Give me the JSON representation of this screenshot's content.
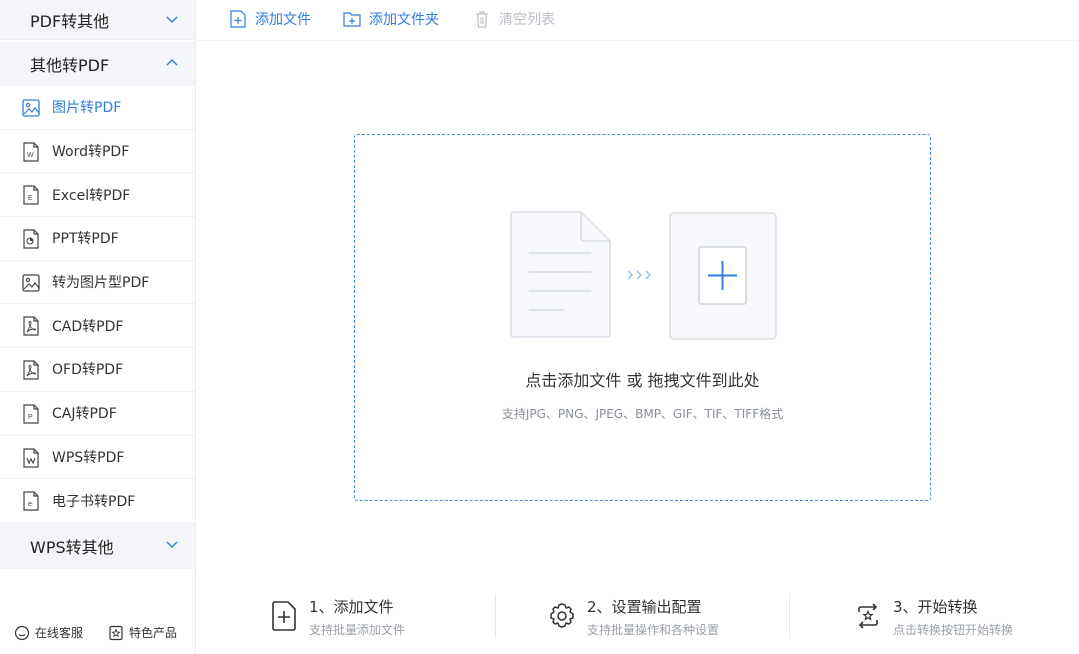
{
  "sidebar": {
    "groups": [
      {
        "label": "PDF转其他",
        "expanded": false
      },
      {
        "label": "其他转PDF",
        "expanded": true
      },
      {
        "label": "WPS转其他",
        "expanded": false
      }
    ],
    "items": [
      {
        "label": "图片转PDF",
        "icon": "image-icon",
        "active": true
      },
      {
        "label": "Word转PDF",
        "icon": "word-doc-icon",
        "active": false
      },
      {
        "label": "Excel转PDF",
        "icon": "excel-doc-icon",
        "active": false
      },
      {
        "label": "PPT转PDF",
        "icon": "ppt-doc-icon",
        "active": false
      },
      {
        "label": "转为图片型PDF",
        "icon": "image-icon",
        "active": false
      },
      {
        "label": "CAD转PDF",
        "icon": "pdf-doc-icon",
        "active": false
      },
      {
        "label": "OFD转PDF",
        "icon": "pdf-doc-icon",
        "active": false
      },
      {
        "label": "CAJ转PDF",
        "icon": "caj-doc-icon",
        "active": false
      },
      {
        "label": "WPS转PDF",
        "icon": "wps-doc-icon",
        "active": false
      },
      {
        "label": "电子书转PDF",
        "icon": "ebook-doc-icon",
        "active": false
      }
    ],
    "footer": {
      "support_label": "在线客服",
      "features_label": "特色产品"
    }
  },
  "toolbar": {
    "add_file_label": "添加文件",
    "add_folder_label": "添加文件夹",
    "clear_list_label": "清空列表"
  },
  "dropzone": {
    "title": "点击添加文件 或 拖拽文件到此处",
    "subtitle": "支持JPG、PNG、JPEG、BMP、GIF、TIF、TIFF格式"
  },
  "steps": [
    {
      "title": "1、添加文件",
      "desc": "支持批量添加文件",
      "icon": "add-file-icon"
    },
    {
      "title": "2、设置输出配置",
      "desc": "支持批量操作和各种设置",
      "icon": "gear-icon"
    },
    {
      "title": "3、开始转换",
      "desc": "点击转换按钮开始转换",
      "icon": "convert-icon"
    }
  ],
  "colors": {
    "accent": "#2f7de1",
    "sidebar_group_bg": "#f3f5f8",
    "disabled": "#b9bec6",
    "dropzone_border": "#3f8ee6"
  }
}
